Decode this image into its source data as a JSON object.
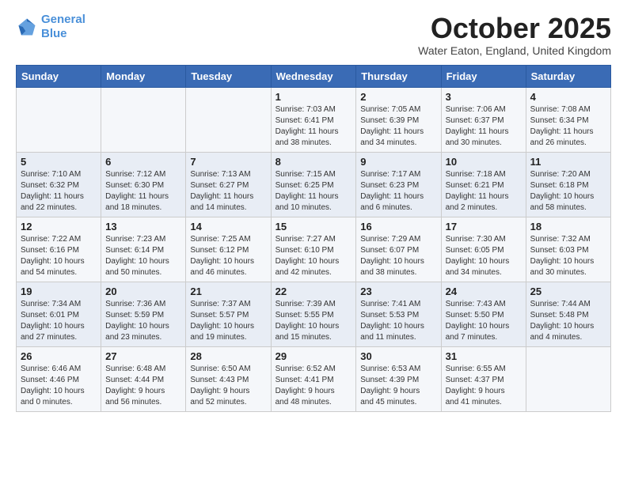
{
  "header": {
    "logo_line1": "General",
    "logo_line2": "Blue",
    "month_title": "October 2025",
    "location": "Water Eaton, England, United Kingdom"
  },
  "days_of_week": [
    "Sunday",
    "Monday",
    "Tuesday",
    "Wednesday",
    "Thursday",
    "Friday",
    "Saturday"
  ],
  "weeks": [
    [
      {
        "day": "",
        "info": ""
      },
      {
        "day": "",
        "info": ""
      },
      {
        "day": "",
        "info": ""
      },
      {
        "day": "1",
        "info": "Sunrise: 7:03 AM\nSunset: 6:41 PM\nDaylight: 11 hours\nand 38 minutes."
      },
      {
        "day": "2",
        "info": "Sunrise: 7:05 AM\nSunset: 6:39 PM\nDaylight: 11 hours\nand 34 minutes."
      },
      {
        "day": "3",
        "info": "Sunrise: 7:06 AM\nSunset: 6:37 PM\nDaylight: 11 hours\nand 30 minutes."
      },
      {
        "day": "4",
        "info": "Sunrise: 7:08 AM\nSunset: 6:34 PM\nDaylight: 11 hours\nand 26 minutes."
      }
    ],
    [
      {
        "day": "5",
        "info": "Sunrise: 7:10 AM\nSunset: 6:32 PM\nDaylight: 11 hours\nand 22 minutes."
      },
      {
        "day": "6",
        "info": "Sunrise: 7:12 AM\nSunset: 6:30 PM\nDaylight: 11 hours\nand 18 minutes."
      },
      {
        "day": "7",
        "info": "Sunrise: 7:13 AM\nSunset: 6:27 PM\nDaylight: 11 hours\nand 14 minutes."
      },
      {
        "day": "8",
        "info": "Sunrise: 7:15 AM\nSunset: 6:25 PM\nDaylight: 11 hours\nand 10 minutes."
      },
      {
        "day": "9",
        "info": "Sunrise: 7:17 AM\nSunset: 6:23 PM\nDaylight: 11 hours\nand 6 minutes."
      },
      {
        "day": "10",
        "info": "Sunrise: 7:18 AM\nSunset: 6:21 PM\nDaylight: 11 hours\nand 2 minutes."
      },
      {
        "day": "11",
        "info": "Sunrise: 7:20 AM\nSunset: 6:18 PM\nDaylight: 10 hours\nand 58 minutes."
      }
    ],
    [
      {
        "day": "12",
        "info": "Sunrise: 7:22 AM\nSunset: 6:16 PM\nDaylight: 10 hours\nand 54 minutes."
      },
      {
        "day": "13",
        "info": "Sunrise: 7:23 AM\nSunset: 6:14 PM\nDaylight: 10 hours\nand 50 minutes."
      },
      {
        "day": "14",
        "info": "Sunrise: 7:25 AM\nSunset: 6:12 PM\nDaylight: 10 hours\nand 46 minutes."
      },
      {
        "day": "15",
        "info": "Sunrise: 7:27 AM\nSunset: 6:10 PM\nDaylight: 10 hours\nand 42 minutes."
      },
      {
        "day": "16",
        "info": "Sunrise: 7:29 AM\nSunset: 6:07 PM\nDaylight: 10 hours\nand 38 minutes."
      },
      {
        "day": "17",
        "info": "Sunrise: 7:30 AM\nSunset: 6:05 PM\nDaylight: 10 hours\nand 34 minutes."
      },
      {
        "day": "18",
        "info": "Sunrise: 7:32 AM\nSunset: 6:03 PM\nDaylight: 10 hours\nand 30 minutes."
      }
    ],
    [
      {
        "day": "19",
        "info": "Sunrise: 7:34 AM\nSunset: 6:01 PM\nDaylight: 10 hours\nand 27 minutes."
      },
      {
        "day": "20",
        "info": "Sunrise: 7:36 AM\nSunset: 5:59 PM\nDaylight: 10 hours\nand 23 minutes."
      },
      {
        "day": "21",
        "info": "Sunrise: 7:37 AM\nSunset: 5:57 PM\nDaylight: 10 hours\nand 19 minutes."
      },
      {
        "day": "22",
        "info": "Sunrise: 7:39 AM\nSunset: 5:55 PM\nDaylight: 10 hours\nand 15 minutes."
      },
      {
        "day": "23",
        "info": "Sunrise: 7:41 AM\nSunset: 5:53 PM\nDaylight: 10 hours\nand 11 minutes."
      },
      {
        "day": "24",
        "info": "Sunrise: 7:43 AM\nSunset: 5:50 PM\nDaylight: 10 hours\nand 7 minutes."
      },
      {
        "day": "25",
        "info": "Sunrise: 7:44 AM\nSunset: 5:48 PM\nDaylight: 10 hours\nand 4 minutes."
      }
    ],
    [
      {
        "day": "26",
        "info": "Sunrise: 6:46 AM\nSunset: 4:46 PM\nDaylight: 10 hours\nand 0 minutes."
      },
      {
        "day": "27",
        "info": "Sunrise: 6:48 AM\nSunset: 4:44 PM\nDaylight: 9 hours\nand 56 minutes."
      },
      {
        "day": "28",
        "info": "Sunrise: 6:50 AM\nSunset: 4:43 PM\nDaylight: 9 hours\nand 52 minutes."
      },
      {
        "day": "29",
        "info": "Sunrise: 6:52 AM\nSunset: 4:41 PM\nDaylight: 9 hours\nand 48 minutes."
      },
      {
        "day": "30",
        "info": "Sunrise: 6:53 AM\nSunset: 4:39 PM\nDaylight: 9 hours\nand 45 minutes."
      },
      {
        "day": "31",
        "info": "Sunrise: 6:55 AM\nSunset: 4:37 PM\nDaylight: 9 hours\nand 41 minutes."
      },
      {
        "day": "",
        "info": ""
      }
    ]
  ]
}
